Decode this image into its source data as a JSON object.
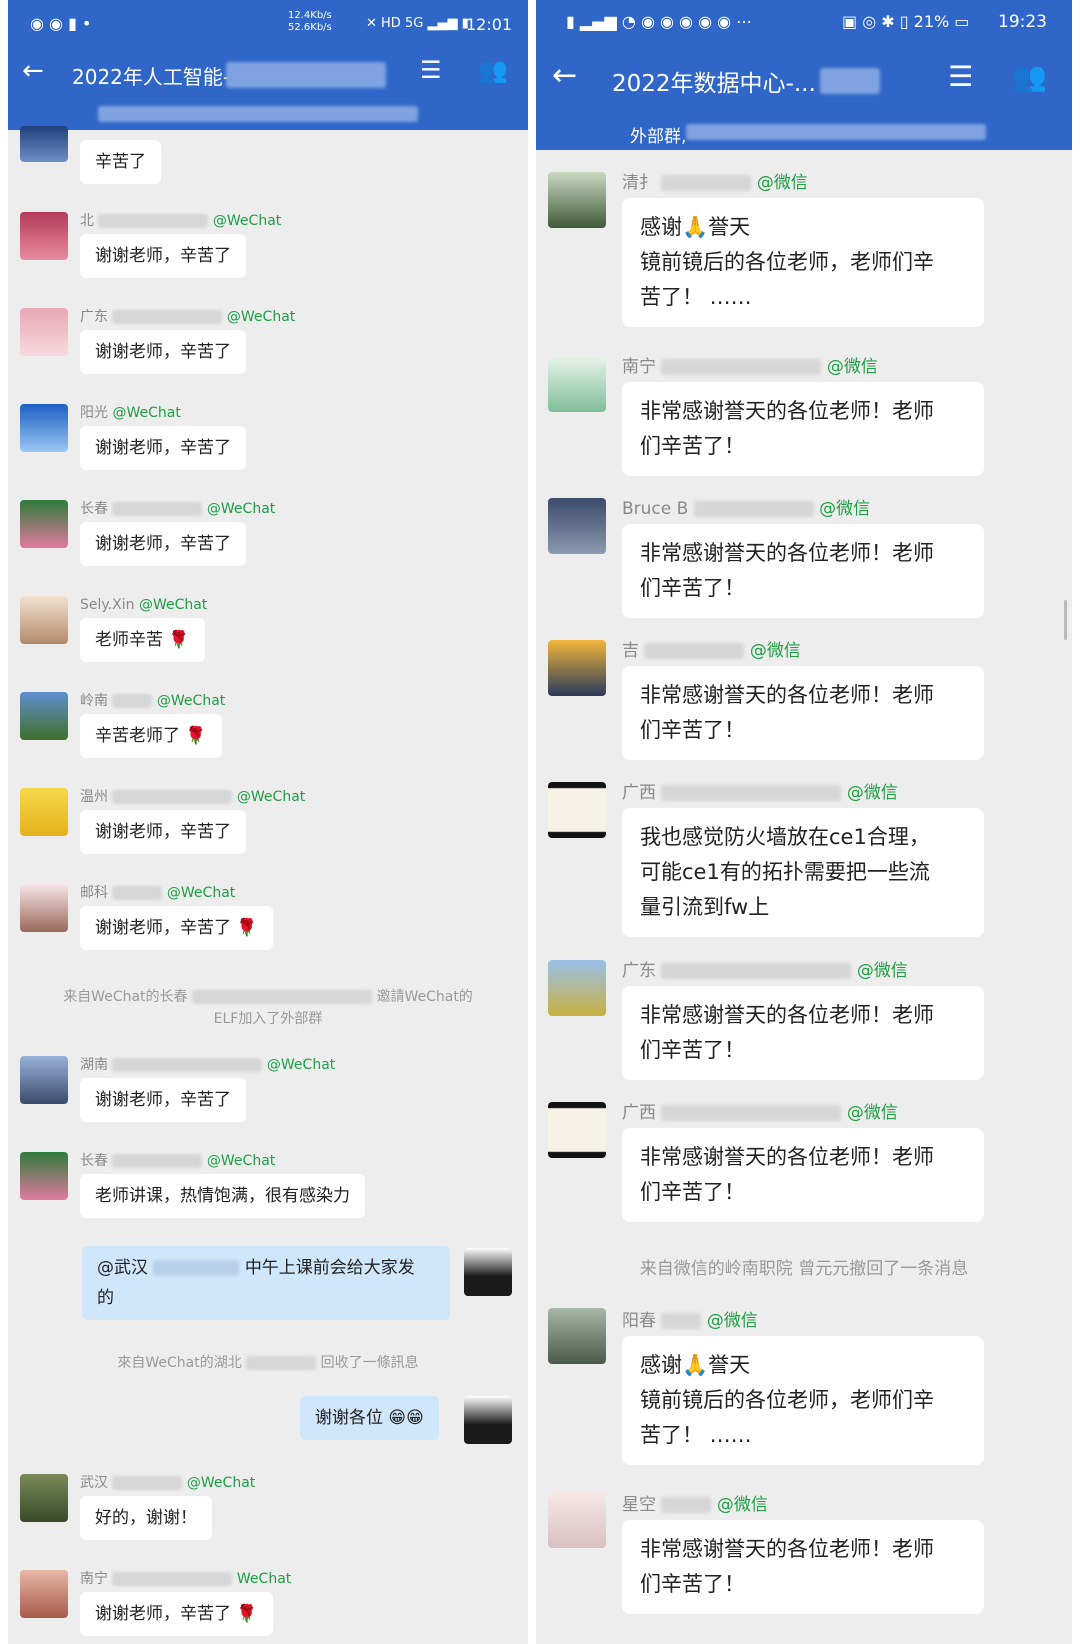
{
  "left": {
    "status": {
      "speed_up": "12.4Kb/s",
      "speed_down": "52.6Kb/s",
      "hd": "HD",
      "net": "5G",
      "time": "12:01"
    },
    "title": "2022年人工智能-",
    "messages": [
      {
        "text": "辛苦了"
      },
      {
        "name": "北",
        "tag": "@WeChat",
        "text": "谢谢老师，辛苦了"
      },
      {
        "name": "广东",
        "tag": "@WeChat",
        "text": "谢谢老师，辛苦了"
      },
      {
        "name": "阳光",
        "tag": "@WeChat",
        "text": "谢谢老师，辛苦了"
      },
      {
        "name": "长春",
        "tag": "@WeChat",
        "text": "谢谢老师，辛苦了"
      },
      {
        "name": "Sely.Xin",
        "tag": "@WeChat",
        "text": "老师辛苦"
      },
      {
        "name": "岭南",
        "tag": "@WeChat",
        "text": "辛苦老师了"
      },
      {
        "name": "温州",
        "tag": "@WeChat",
        "text": "谢谢老师，辛苦了"
      },
      {
        "name": "邮科",
        "tag": "@WeChat",
        "text": "谢谢老师，辛苦了"
      },
      {
        "name": "湖南",
        "tag": "@WeChat",
        "text": "谢谢老师，辛苦了"
      },
      {
        "name": "长春",
        "tag": "@WeChat",
        "text": "老师讲课，热情饱满，很有感染力"
      },
      {
        "name": "武汉",
        "tag": "@WeChat",
        "text": "好的，谢谢！"
      },
      {
        "name": "南宁",
        "tag": "WeChat",
        "text": "谢谢老师，辛苦了"
      }
    ],
    "sys1_a": "来自WeChat的长春",
    "sys1_b": "邀請WeChat的",
    "sys1_c": "ELF加入了外部群",
    "me1_a": "@武汉",
    "me1_b": "中午上课前会给大家发",
    "me1_c": "的",
    "sys2_a": "來自WeChat的湖北",
    "sys2_b": "回收了一條訊息",
    "me2": "谢谢各位"
  },
  "right": {
    "status": {
      "battery": "21%",
      "time": "19:23"
    },
    "title": "2022年数据中心-...",
    "subtitle": "外部群,",
    "messages": [
      {
        "name": "清扌",
        "tag": "@微信",
        "lines": [
          "感谢🙏誉天",
          "镜前镜后的各位老师，老师们辛",
          "苦了！ ……"
        ]
      },
      {
        "name": "南宁",
        "tag": "@微信",
        "lines": [
          "非常感谢誉天的各位老师！老师",
          "们辛苦了！"
        ]
      },
      {
        "name": "Bruce B",
        "tag": "@微信",
        "lines": [
          "非常感谢誉天的各位老师！老师",
          "们辛苦了！"
        ]
      },
      {
        "name": "吉",
        "tag": "@微信",
        "lines": [
          "非常感谢誉天的各位老师！老师",
          "们辛苦了！"
        ]
      },
      {
        "name": "广西",
        "tag": "@微信",
        "lines": [
          "我也感觉防火墙放在ce1合理，",
          "可能ce1有的拓扑需要把一些流",
          "量引流到fw上"
        ]
      },
      {
        "name": "广东",
        "tag": "@微信",
        "lines": [
          "非常感谢誉天的各位老师！老师",
          "们辛苦了！"
        ]
      },
      {
        "name": "广西",
        "tag": "@微信",
        "lines": [
          "非常感谢誉天的各位老师！老师",
          "们辛苦了！"
        ]
      },
      {
        "name": "阳春",
        "tag": "@微信",
        "lines": [
          "感谢🙏誉天",
          "镜前镜后的各位老师，老师们辛",
          "苦了！ ……"
        ]
      },
      {
        "name": "星空",
        "tag": "@微信",
        "lines": [
          "非常感谢誉天的各位老师！老师",
          "们辛苦了！"
        ]
      }
    ],
    "sys": "来自微信的岭南职院 曾元元撤回了一条消息"
  },
  "colors": {
    "header": "#2f66c8",
    "chat_bg": "#ededed",
    "wechat_tag": "#1f9e44",
    "my_bubble": "#cfe6fb"
  }
}
